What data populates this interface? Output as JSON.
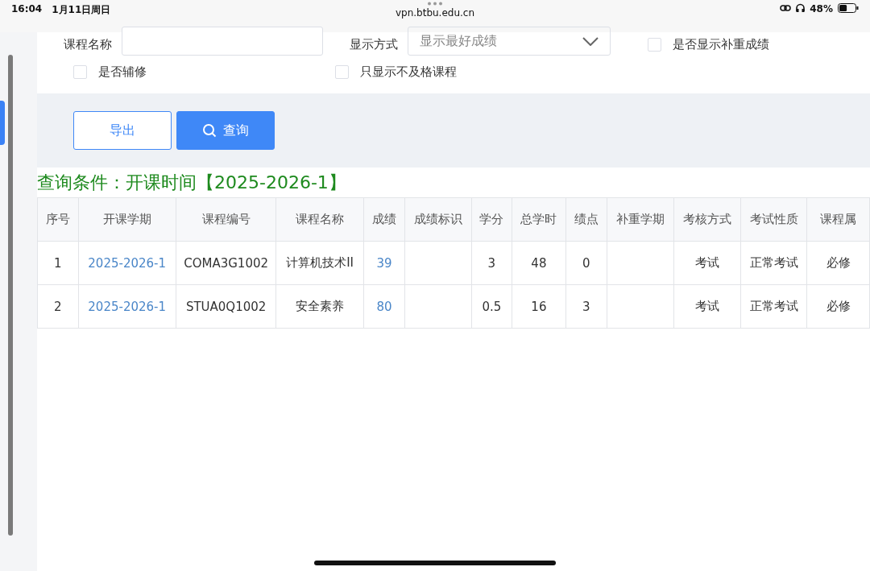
{
  "status_bar": {
    "time": "16:04",
    "date": "1月11日周日",
    "url": "vpn.btbu.edu.cn",
    "battery": "48%"
  },
  "filters": {
    "course_name": {
      "label": "课程名称"
    },
    "display_mode": {
      "label": "显示方式",
      "value": "显示最好成绩"
    },
    "checkboxes": [
      {
        "label": "是否显示补重成绩",
        "checked": false
      },
      {
        "label": "是否辅修",
        "checked": false
      },
      {
        "label": "只显示不及格课程",
        "checked": false
      }
    ]
  },
  "buttons": [
    {
      "kind": "outline",
      "label": "导出"
    },
    {
      "kind": "primary",
      "label": "查询"
    }
  ],
  "query_condition": "查询条件：开课时间【2025-2026-1】",
  "table": {
    "columns": [
      "序号",
      "开课学期",
      "课程编号",
      "课程名称",
      "成绩",
      "成绩标识",
      "学分",
      "总学时",
      "绩点",
      "补重学期",
      "考核方式",
      "考试性质",
      "课程属"
    ],
    "rows": [
      [
        "1",
        "2025-2026-1",
        "COMA3G1002",
        "计算机技术II",
        "39",
        "",
        "3",
        "48",
        "0",
        "",
        "考试",
        "正常考试",
        "必修"
      ],
      [
        "2",
        "2025-2026-1",
        "STUA0Q1002",
        "安全素养",
        "80",
        "",
        "0.5",
        "16",
        "3",
        "",
        "考试",
        "正常考试",
        "必修"
      ]
    ]
  }
}
